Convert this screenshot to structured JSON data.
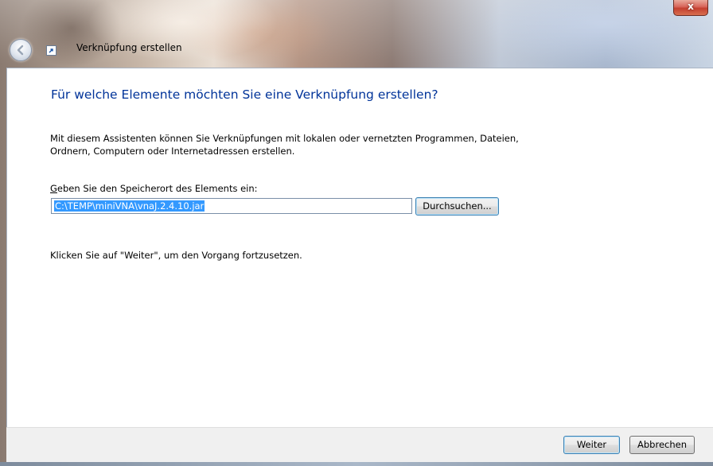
{
  "window": {
    "title": "Verknüpfung erstellen",
    "close_label": "x"
  },
  "content": {
    "heading": "Für welche Elemente möchten Sie eine Verknüpfung erstellen?",
    "description_line1": "Mit diesem Assistenten können Sie Verknüpfungen mit lokalen oder vernetzten Programmen, Dateien,",
    "description_line2": "Ordnern, Computern oder Internetadressen erstellen.",
    "location_label_accel": "G",
    "location_label_rest": "eben Sie den Speicherort des Elements ein:",
    "location_value": "C:\\TEMP\\miniVNA\\vnaJ.2.4.10.jar",
    "browse_label": "Durchsuchen...",
    "hint": "Klicken Sie auf \"Weiter\", um den Vorgang fortzusetzen."
  },
  "buttons": {
    "next_label": "Weiter",
    "cancel_label": "Abbrechen"
  },
  "icons": {
    "back": "back-arrow-icon",
    "app": "shortcut-icon",
    "close": "close-icon"
  }
}
